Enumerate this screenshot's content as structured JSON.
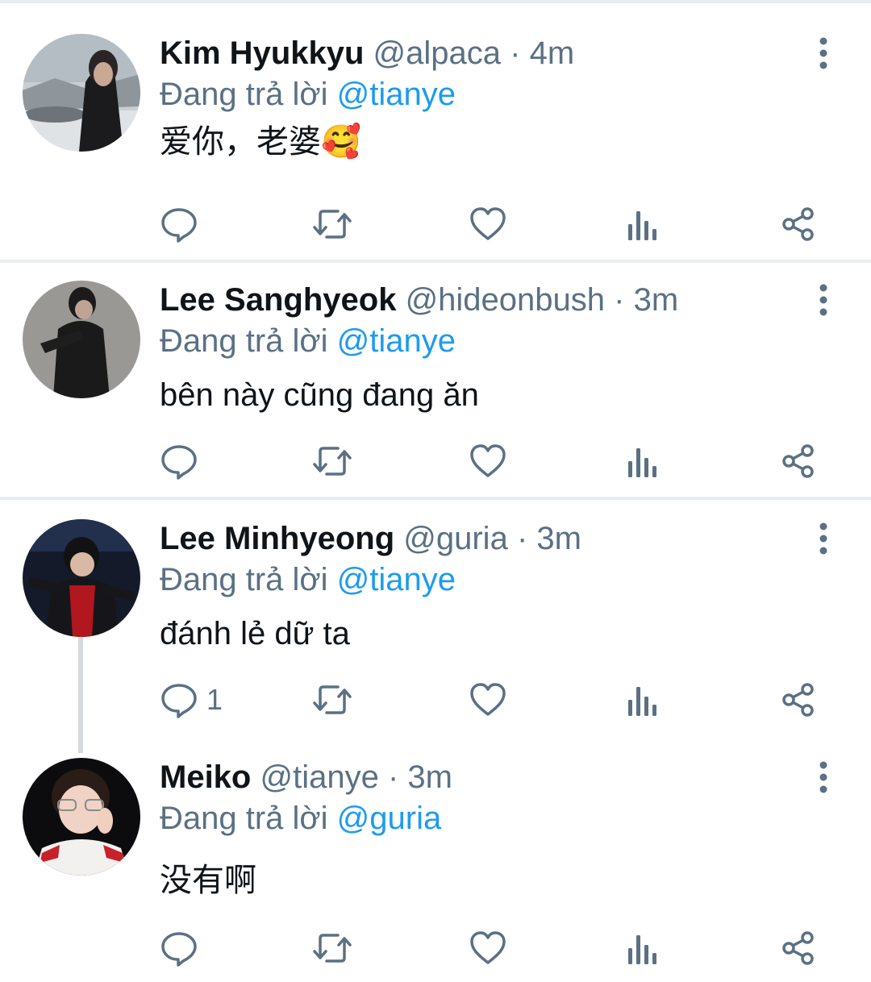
{
  "reply_prefix": "Đang trả lời",
  "colors": {
    "accent": "#1d9bf0",
    "secondary_text": "#5b7083",
    "icon": "#5b7083",
    "divider": "#e9edf0"
  },
  "tweets": [
    {
      "name": "Kim Hyukkyu",
      "handle": "@alpaca",
      "time": "4m",
      "replying_to": "@tianye",
      "text": "爱你，老婆🥰",
      "reply_count": ""
    },
    {
      "name": "Lee Sanghyeok",
      "handle": "@hideonbush",
      "time": "3m",
      "replying_to": "@tianye",
      "text": "bên này cũng đang ăn",
      "reply_count": ""
    },
    {
      "name": "Lee Minhyeong",
      "handle": "@guria",
      "time": "3m",
      "replying_to": "@tianye",
      "text": "đánh lẻ dữ ta",
      "reply_count": "1"
    },
    {
      "name": "Meiko",
      "handle": "@tianye",
      "time": "3m",
      "replying_to": "@guria",
      "text": "没有啊",
      "reply_count": ""
    }
  ],
  "action_icons": [
    "reply-icon",
    "retweet-icon",
    "like-icon",
    "analytics-icon",
    "share-icon"
  ]
}
